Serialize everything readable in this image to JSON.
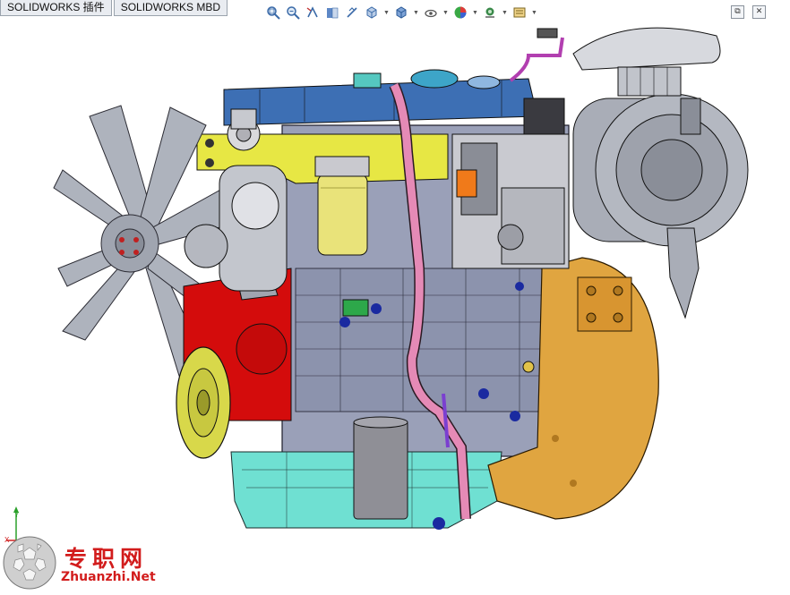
{
  "tabs": [
    {
      "label": "SOLIDWORKS 插件"
    },
    {
      "label": "SOLIDWORKS MBD"
    }
  ],
  "heads_up_toolbar": {
    "icons": [
      "zoom-to-fit-icon",
      "zoom-to-area-icon",
      "previous-view-icon",
      "section-view-icon",
      "dynamic-annotation-icon",
      "view-orientation-icon",
      "display-style-icon",
      "hide-show-items-icon",
      "edit-appearance-icon",
      "apply-scene-icon",
      "view-settings-icon"
    ]
  },
  "window_controls": {
    "restore": "⧉",
    "close": "✕"
  },
  "viewport": {
    "model": "diesel-engine-assembly",
    "colors": {
      "block": "#9aa0b8",
      "fan": "#aeb3bd",
      "timing_cover": "#d40c0c",
      "pulley": "#d8d84a",
      "flywheel_housing": "#e0a540",
      "oil_pan": "#6fe0d2",
      "valve_cover": "#3d6fb4",
      "filter": "#e9e37a",
      "hose": "#e58ab6",
      "air_cleaner": "#a9adb7",
      "oil_filter": "#8f8f96"
    }
  },
  "watermark": {
    "text_cn": "专职网",
    "text_url": "Zhuanzhi.Net"
  }
}
